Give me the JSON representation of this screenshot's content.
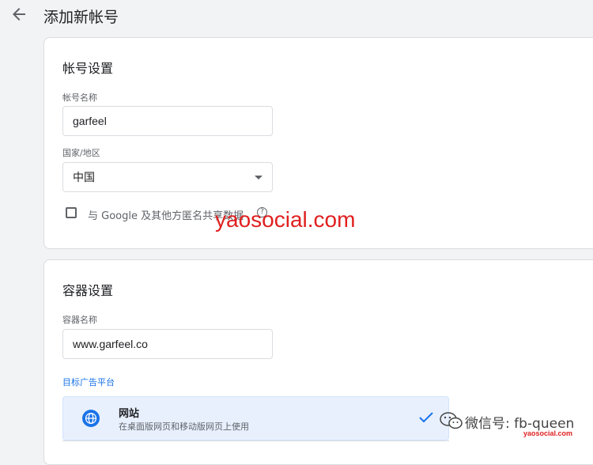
{
  "header": {
    "title": "添加新帐号"
  },
  "account_settings": {
    "title": "帐号设置",
    "name_label": "帐号名称",
    "name_value": "garfeel",
    "country_label": "国家/地区",
    "country_value": "中国",
    "share_label": "与 Google 及其他方匿名共享数据",
    "share_checked": false
  },
  "container_settings": {
    "title": "容器设置",
    "name_label": "容器名称",
    "name_value": "www.garfeel.co",
    "platform_label": "目标广告平台",
    "platforms": [
      {
        "name": "网站",
        "description": "在桌面版网页和移动版网页上使用",
        "selected": true,
        "icon": "globe-icon"
      }
    ]
  },
  "watermark": {
    "text": "yaosocial.com"
  },
  "wechat": {
    "text": "微信号: fb-queen",
    "sub": "yaosocial.com"
  },
  "colors": {
    "accent": "#1a73e8",
    "selected_bg": "#e8f0fe",
    "watermark": "#e02020"
  }
}
